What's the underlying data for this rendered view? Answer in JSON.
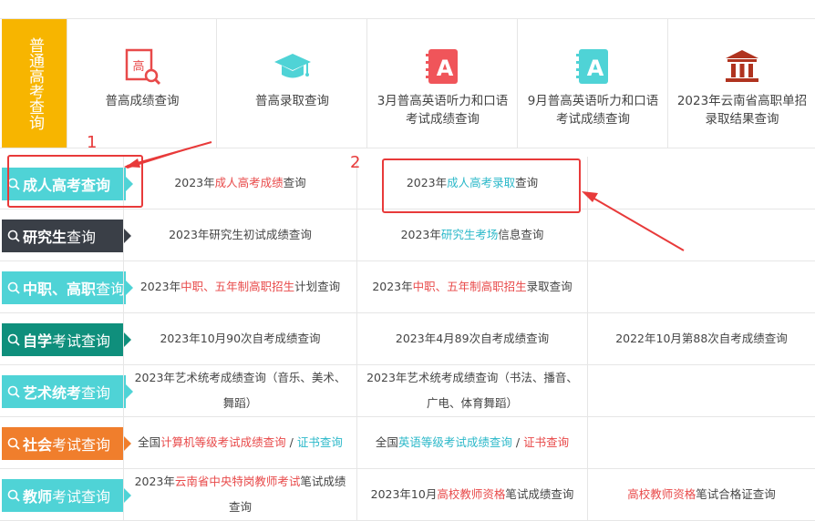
{
  "top": {
    "label": "普通高考查询",
    "items": [
      {
        "text": "普高成绩查询",
        "icon": "gaokao-score-icon"
      },
      {
        "text": "普高录取查询",
        "icon": "graduation-cap-icon"
      },
      {
        "text": "3月普高英语听力和口语考试成绩查询",
        "icon": "notebook-a-icon"
      },
      {
        "text": "9月普高英语听力和口语考试成绩查询",
        "icon": "notebook-a-icon"
      },
      {
        "text": "2023年云南省高职单招录取结果查询",
        "icon": "building-icon"
      }
    ]
  },
  "rows": [
    {
      "badge": {
        "strong": "成人高考查询",
        "rest": ""
      },
      "cells": [
        [
          {
            "t": "2023年"
          },
          {
            "t": "成人高考成绩",
            "c": "red"
          },
          {
            "t": "查询"
          }
        ],
        [
          {
            "t": "2023年"
          },
          {
            "t": "成人高考录取",
            "c": "cyan"
          },
          {
            "t": "查询"
          }
        ],
        []
      ]
    },
    {
      "badge": {
        "strong": "研究生",
        "rest": "查询"
      },
      "cells": [
        [
          {
            "t": "2023年研究生初试成绩查询"
          }
        ],
        [
          {
            "t": "2023年"
          },
          {
            "t": "研究生考场",
            "c": "cyan"
          },
          {
            "t": "信息查询"
          }
        ],
        []
      ]
    },
    {
      "badge": {
        "strong": "中职、高职",
        "rest": "查询"
      },
      "cells": [
        [
          {
            "t": "2023年"
          },
          {
            "t": "中职、五年制高职招生",
            "c": "red"
          },
          {
            "t": "计划查询"
          }
        ],
        [
          {
            "t": "2023年"
          },
          {
            "t": "中职、五年制高职招生",
            "c": "red"
          },
          {
            "t": "录取查询"
          }
        ],
        []
      ]
    },
    {
      "badge": {
        "strong": "自学",
        "rest": "考试查询"
      },
      "cells": [
        [
          {
            "t": "2023年10月90次自考成绩查询"
          }
        ],
        [
          {
            "t": "2023年4月89次自考成绩查询"
          }
        ],
        [
          {
            "t": "2022年10月第88次自考成绩查询"
          }
        ]
      ]
    },
    {
      "badge": {
        "strong": "艺术统考",
        "rest": "查询"
      },
      "cells": [
        [
          {
            "t": "2023年艺术统考成绩查询（音乐、美术、舞蹈）"
          }
        ],
        [
          {
            "t": "2023年艺术统考成绩查询（书法、播音、广电、体育舞蹈）"
          }
        ],
        []
      ]
    },
    {
      "badge": {
        "strong": "社会",
        "rest": "考试查询"
      },
      "cells": [
        [
          {
            "t": "全国"
          },
          {
            "t": "计算机等级考试成绩查询",
            "c": "red"
          },
          {
            "t": " / "
          },
          {
            "t": "证书查询",
            "c": "cyan"
          }
        ],
        [
          {
            "t": "全国"
          },
          {
            "t": "英语等级考试成绩查询",
            "c": "cyan"
          },
          {
            "t": " / "
          },
          {
            "t": "证书查询",
            "c": "red"
          }
        ],
        []
      ]
    },
    {
      "badge": {
        "strong": "教师",
        "rest": "考试查询"
      },
      "cells": [
        [
          {
            "t": "2023年"
          },
          {
            "t": "云南省中央特岗教师考试",
            "c": "red"
          },
          {
            "t": "笔试成绩查询"
          }
        ],
        [
          {
            "t": "2023年10月"
          },
          {
            "t": "高校教师资格",
            "c": "red"
          },
          {
            "t": "笔试成绩查询"
          }
        ],
        [
          {
            "t": "高校教师资格",
            "c": "red"
          },
          {
            "t": "笔试合格证查询"
          }
        ]
      ]
    }
  ],
  "annotations": {
    "n1": "1",
    "n2": "2"
  },
  "colors": {
    "top_label": "#f7b500",
    "badges": [
      "#4fd3d6",
      "#3a3f47",
      "#4fd3d6",
      "#0f8f7c",
      "#4fd3d6",
      "#f07e2c",
      "#4fd3d6"
    ],
    "accent_red": "#e84a4a",
    "accent_cyan": "#2bb8c9",
    "annotation": "#e83a3a"
  }
}
